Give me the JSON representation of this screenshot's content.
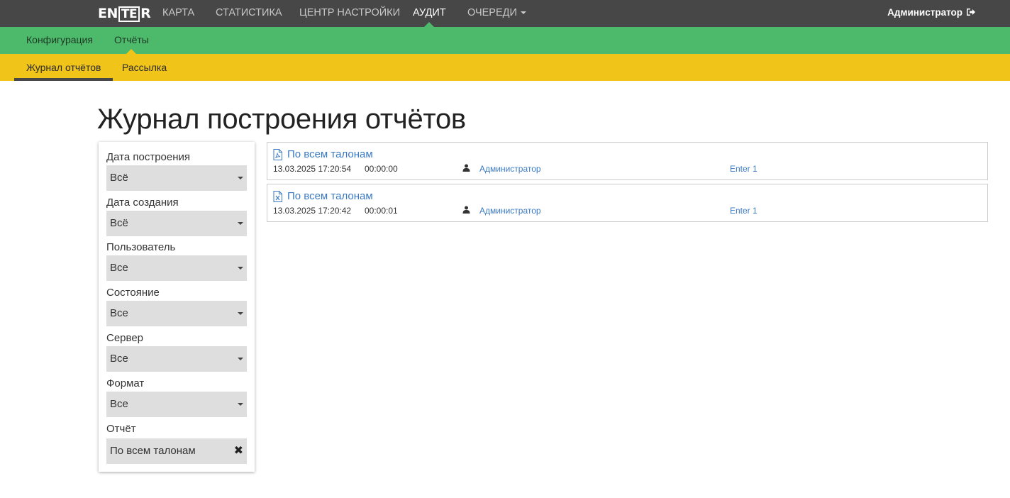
{
  "topnav": {
    "logo": {
      "pre": "EN",
      "box": "TE",
      "post": "R"
    },
    "items": [
      {
        "label": "КАРТА"
      },
      {
        "label": "СТАТИСТИКА"
      },
      {
        "label": "ЦЕНТР НАСТРОЙКИ"
      },
      {
        "label": "АУДИТ",
        "active": true
      },
      {
        "label": "ОЧЕРЕДИ"
      }
    ],
    "user": "Администратор"
  },
  "subnav": {
    "items": [
      {
        "label": "Конфигурация"
      },
      {
        "label": "Отчёты",
        "active": true
      }
    ]
  },
  "tabs": {
    "items": [
      {
        "label": "Журнал отчётов",
        "active": true
      },
      {
        "label": "Рассылка"
      }
    ]
  },
  "page": {
    "title": "Журнал построения отчётов"
  },
  "filters": [
    {
      "label": "Дата построения",
      "value": "Всё"
    },
    {
      "label": "Дата создания",
      "value": "Всё"
    },
    {
      "label": "Пользователь",
      "value": "Все"
    },
    {
      "label": "Состояние",
      "value": "Все"
    },
    {
      "label": "Сервер",
      "value": "Все"
    },
    {
      "label": "Формат",
      "value": "Все"
    },
    {
      "label": "Отчёт",
      "value": "По всем талонам",
      "clearable": true
    }
  ],
  "reports": [
    {
      "title": "По всем талонам",
      "format_icon": "pdf-file-icon",
      "date": "13.03.2025 17:20:54",
      "duration": "00:00:00",
      "user": "Администратор",
      "server": "Enter 1"
    },
    {
      "title": "По всем талонам",
      "format_icon": "excel-file-icon",
      "date": "13.03.2025 17:20:42",
      "duration": "00:00:01",
      "user": "Администратор",
      "server": "Enter 1"
    }
  ],
  "colors": {
    "topbar": "#474747",
    "green": "#4db96a",
    "yellow": "#f0c419",
    "link": "#3b7ac4"
  }
}
